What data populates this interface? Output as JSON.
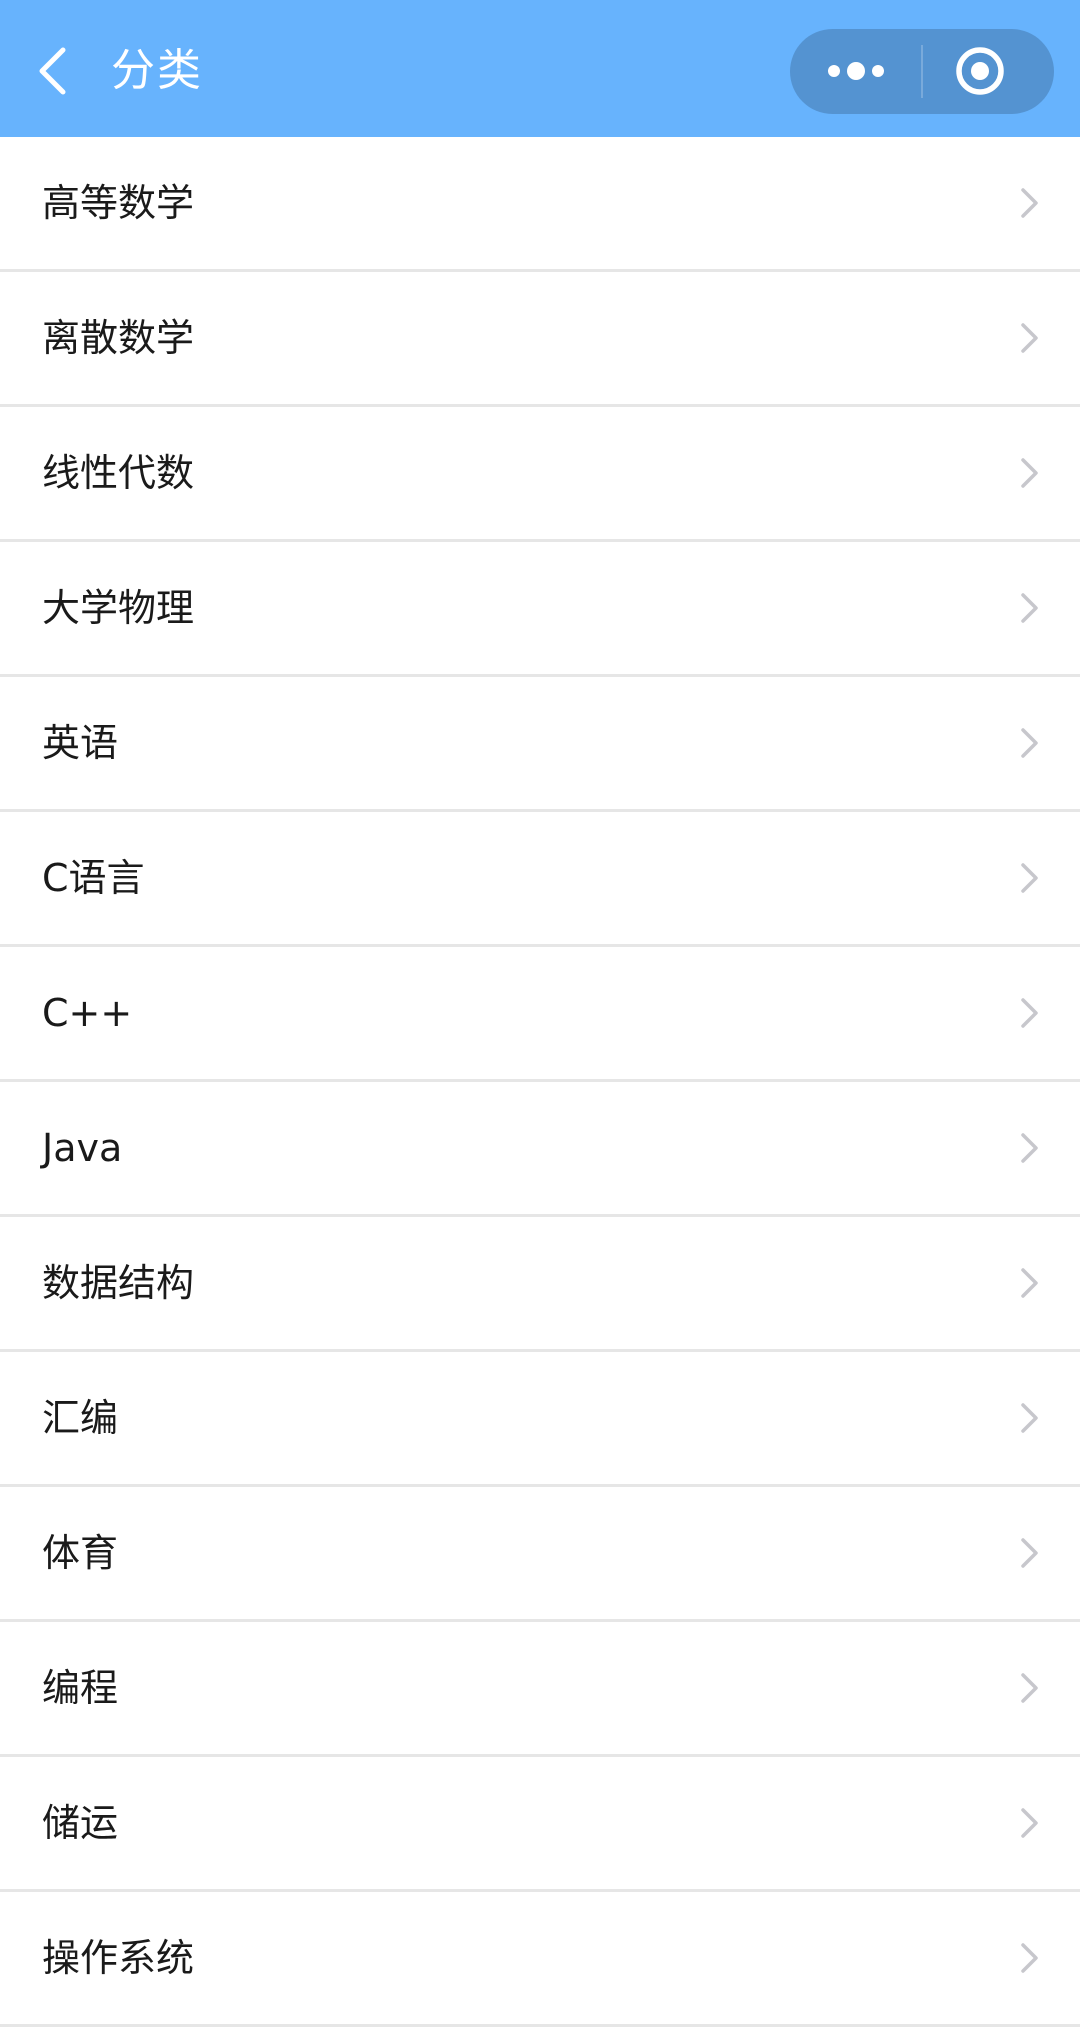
{
  "navbar": {
    "title": "分类",
    "background": "#67b3fd"
  },
  "icons": {
    "back": "chevron-left-icon",
    "more": "more-dots-icon",
    "close": "circle-target-icon",
    "row_arrow": "chevron-right-icon"
  },
  "categories": [
    {
      "label": "高等数学"
    },
    {
      "label": "离散数学"
    },
    {
      "label": "线性代数"
    },
    {
      "label": "大学物理"
    },
    {
      "label": "英语"
    },
    {
      "label": "C语言"
    },
    {
      "label": "C++"
    },
    {
      "label": "Java"
    },
    {
      "label": "数据结构"
    },
    {
      "label": "汇编"
    },
    {
      "label": "体育"
    },
    {
      "label": "编程"
    },
    {
      "label": "储运"
    },
    {
      "label": "操作系统"
    }
  ]
}
